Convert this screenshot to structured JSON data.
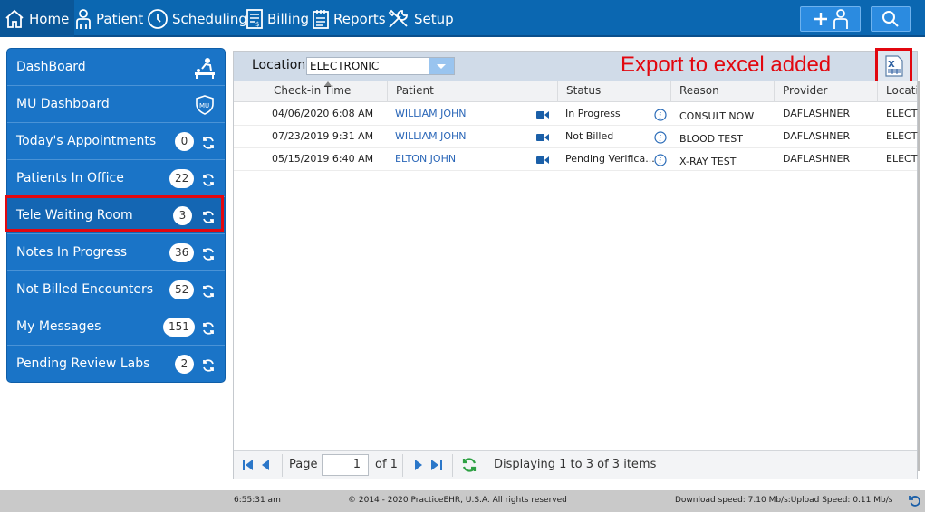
{
  "nav": {
    "home": "Home",
    "patient": "Patient",
    "scheduling": "Scheduling",
    "billing": "Billing",
    "reports": "Reports",
    "setup": "Setup"
  },
  "sidebar": {
    "items": [
      {
        "label": "DashBoard"
      },
      {
        "label": "MU Dashboard",
        "icon_text": "MU"
      },
      {
        "label": "Today's Appointments",
        "count": "0"
      },
      {
        "label": "Patients In Office",
        "count": "22"
      },
      {
        "label": "Tele Waiting Room",
        "count": "3"
      },
      {
        "label": "Notes In Progress",
        "count": "36"
      },
      {
        "label": "Not Billed Encounters",
        "count": "52"
      },
      {
        "label": "My Messages",
        "count": "151"
      },
      {
        "label": "Pending Review Labs",
        "count": "2"
      }
    ]
  },
  "toolbar": {
    "location_label": "Location",
    "location_value": "ELECTRONIC",
    "annotation": "Export to excel added"
  },
  "grid": {
    "columns": [
      "Check-in Time",
      "Patient",
      "Status",
      "Reason",
      "Provider",
      "Locatio"
    ],
    "rows": [
      {
        "checkin": "04/06/2020 6:08 AM",
        "patient": "WILLIAM JOHN",
        "status": "In Progress",
        "reason": "CONSULT NOW",
        "provider": "DAFLASHNER",
        "location": "ELECT"
      },
      {
        "checkin": "07/23/2019 9:31 AM",
        "patient": "WILLIAM JOHN",
        "status": "Not Billed",
        "reason": "BLOOD TEST",
        "provider": "DAFLASHNER",
        "location": "ELECT"
      },
      {
        "checkin": "05/15/2019 6:40 AM",
        "patient": "ELTON JOHN",
        "status": "Pending Verifica...",
        "reason": "X-RAY TEST",
        "provider": "DAFLASHNER",
        "location": "ELECT"
      }
    ]
  },
  "pager": {
    "page_label": "Page",
    "page_value": "1",
    "of_label": "of 1",
    "display_text": "Displaying 1 to 3 of 3 items"
  },
  "footer": {
    "time": "6:55:31 am",
    "copyright": "© 2014 - 2020 PracticeEHR, U.S.A. All rights reserved",
    "speed": "Download speed: 7.10 Mb/s:Upload Speed: 0.11 Mb/s"
  },
  "colors": {
    "nav_bg": "#0b67b1",
    "sidebar_bg": "#1a74c7",
    "highlight": "#e2070f",
    "link": "#2b67b8"
  }
}
